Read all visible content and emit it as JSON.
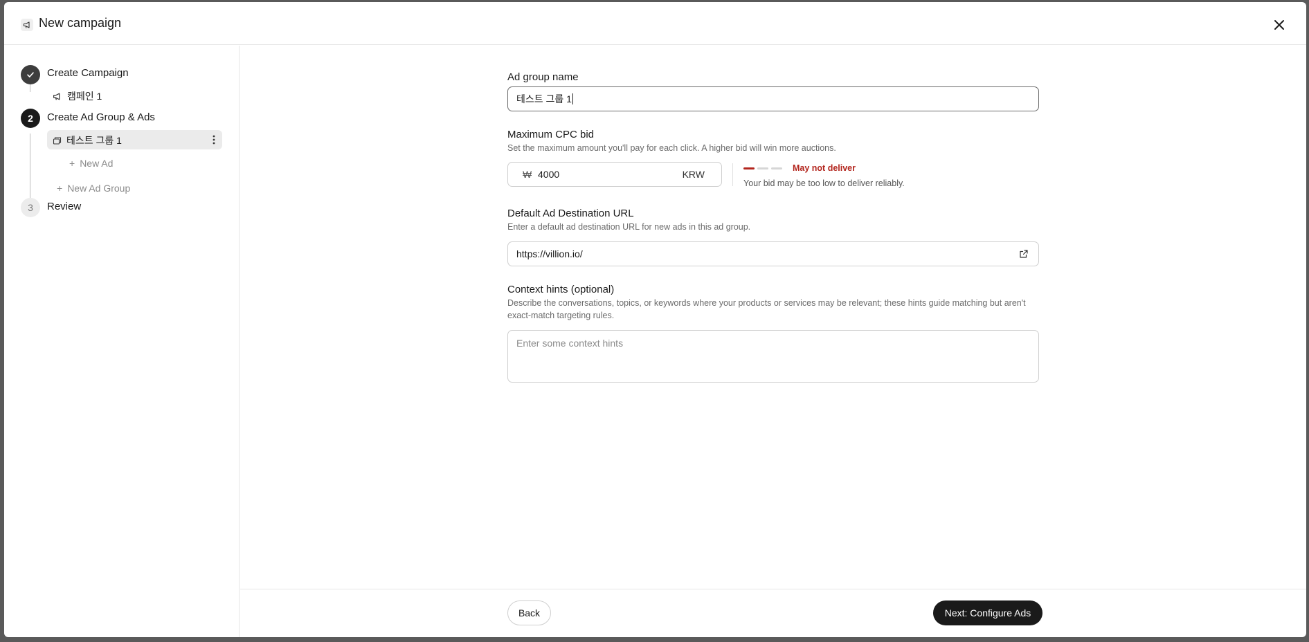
{
  "header": {
    "title": "New campaign",
    "icon": "megaphone-icon",
    "close_icon": "close-icon"
  },
  "sidebar": {
    "steps": [
      {
        "number": "1",
        "label": "Create Campaign",
        "state": "completed",
        "icon": "check-icon"
      },
      {
        "number": "2",
        "label": "Create Ad Group & Ads",
        "state": "active"
      },
      {
        "number": "3",
        "label": "Review",
        "state": "pending"
      }
    ],
    "campaign_item": "캠페인 1",
    "ad_group_item": "테스트 그룹 1",
    "new_ad": "New Ad",
    "new_ad_group": "New Ad Group"
  },
  "form": {
    "ad_group_name": {
      "label": "Ad group name",
      "value": "테스트 그룹 1"
    },
    "cpc_bid": {
      "label": "Maximum CPC bid",
      "help": "Set the maximum amount you'll pay for each click. A higher bid will win more auctions.",
      "currency_symbol": "₩",
      "value": "4000",
      "currency_code": "KRW",
      "strength_level": "1 of 3",
      "strength_colors": [
        "#b3261e",
        "#d6d6d6",
        "#d6d6d6"
      ],
      "status": "May not deliver",
      "status_help": "Your bid may be too low to deliver reliably."
    },
    "destination_url": {
      "label": "Default Ad Destination URL",
      "help": "Enter a default ad destination URL for new ads in this ad group.",
      "value": "https://villion.io/"
    },
    "context_hints": {
      "label": "Context hints (optional)",
      "help": "Describe the conversations, topics, or keywords where your products or services may be relevant; these hints guide matching but aren't exact-match targeting rules.",
      "placeholder": "Enter some context hints"
    }
  },
  "footer": {
    "back_label": "Back",
    "next_label": "Next: Configure Ads"
  }
}
